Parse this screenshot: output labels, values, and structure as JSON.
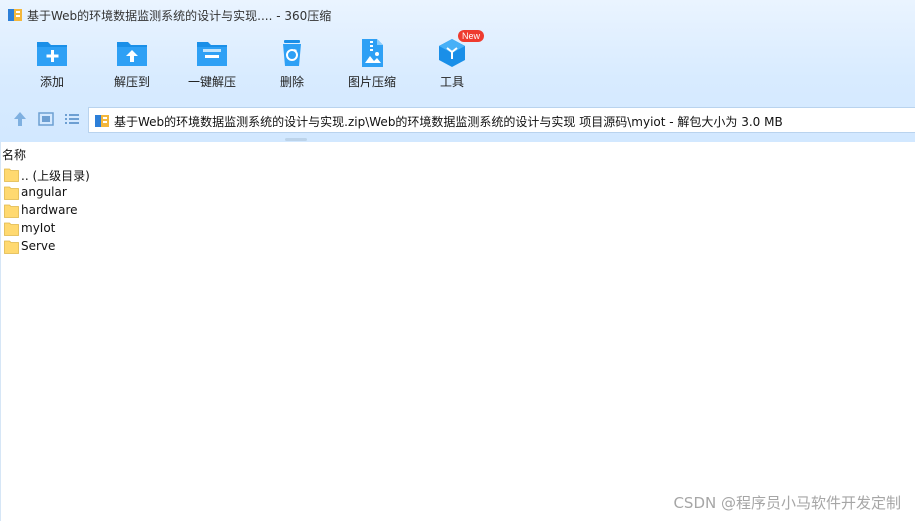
{
  "window": {
    "title": "基于Web的环境数据监测系统的设计与实现.... - 360压缩"
  },
  "toolbar": {
    "items": [
      {
        "label": "添加",
        "icon": "folder-add-icon"
      },
      {
        "label": "解压到",
        "icon": "folder-extract-icon"
      },
      {
        "label": "一键解压",
        "icon": "folder-oneclick-extract-icon"
      },
      {
        "label": "删除",
        "icon": "recycle-bin-icon"
      },
      {
        "label": "图片压缩",
        "icon": "image-compress-icon"
      },
      {
        "label": "工具",
        "icon": "tools-cube-icon",
        "badge": "New"
      }
    ]
  },
  "nav": {
    "buttons": [
      "up-arrow-icon",
      "thumbnail-view-icon",
      "list-view-icon"
    ],
    "address": "基于Web的环境数据监测系统的设计与实现.zip\\Web的环境数据监测系统的设计与实现 项目源码\\myiot - 解包大小为 3.0 MB"
  },
  "list": {
    "columns": {
      "name": "名称"
    },
    "items": [
      {
        "name": ".. (上级目录)"
      },
      {
        "name": "angular"
      },
      {
        "name": "hardware"
      },
      {
        "name": "myIot"
      },
      {
        "name": "Serve"
      }
    ]
  },
  "watermark": "CSDN @程序员小马软件开发定制",
  "colors": {
    "accent": "#1a8fe8",
    "toolbar_bg": "#d8ebff",
    "folder": "#ffd970",
    "badge": "#ee3b2f"
  }
}
